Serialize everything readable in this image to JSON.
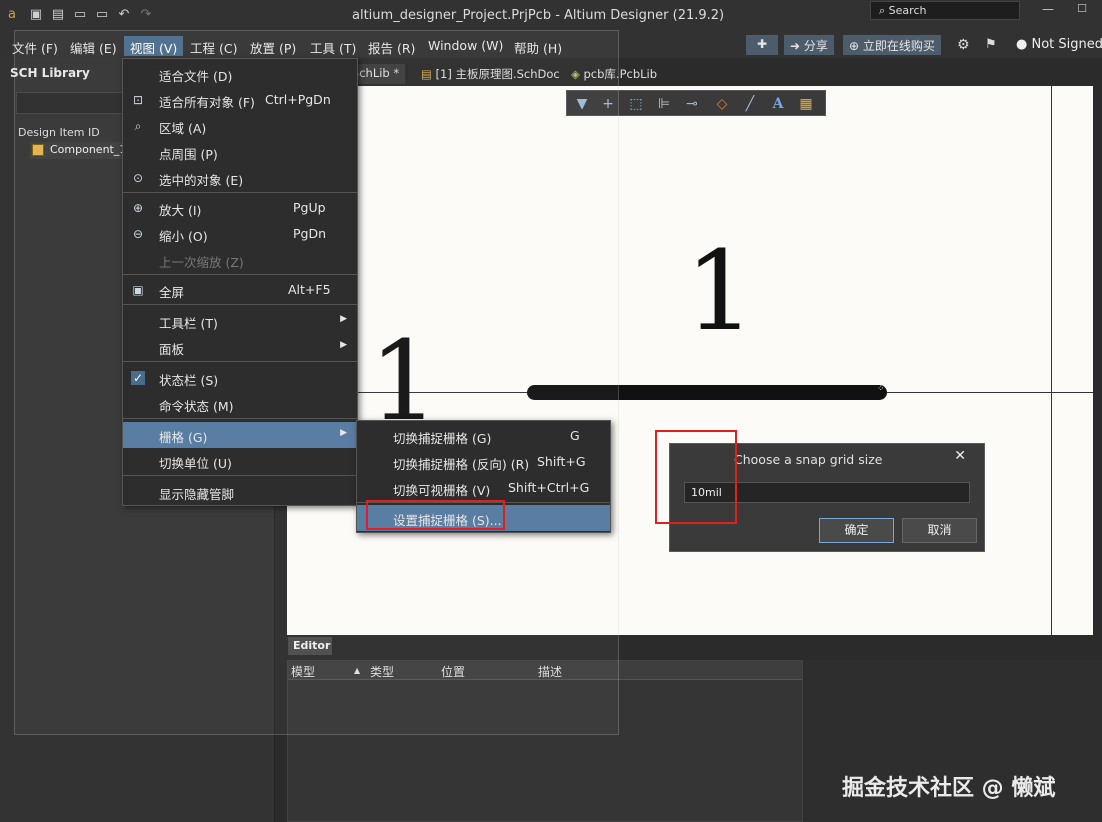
{
  "window": {
    "title": "altium_designer_Project.PrjPcb - Altium Designer (21.9.2)",
    "search_placeholder": "Search"
  },
  "menubar": [
    "文件 (F)",
    "编辑 (E)",
    "视图 (V)",
    "工程 (C)",
    "放置 (P)",
    "工具 (T)",
    "报告 (R)",
    "Window (W)",
    "帮助 (H)"
  ],
  "right_toolbar": {
    "share": "分享",
    "buy": "立即在线购买",
    "user": "Not Signed"
  },
  "left_panel": {
    "title": "SCH Library",
    "column": "Design Item ID",
    "item": "Component_1"
  },
  "tabs": [
    "E.SchLib *",
    "[1] 主板原理图.SchDoc",
    "pcb库.PcbLib"
  ],
  "canvas": {
    "label_top": "1",
    "label_left": "1"
  },
  "view_menu": {
    "items": [
      {
        "label": "适合文件 (D)",
        "shortcut": "",
        "icon": ""
      },
      {
        "label": "适合所有对象 (F)",
        "shortcut": "Ctrl+PgDn",
        "icon": "fit-all-icon"
      },
      {
        "label": "区域 (A)",
        "shortcut": "",
        "icon": "area-zoom-icon"
      },
      {
        "label": "点周围 (P)",
        "shortcut": "",
        "icon": ""
      },
      {
        "label": "选中的对象 (E)",
        "shortcut": "",
        "icon": "selected-zoom-icon"
      },
      {
        "label": "放大 (I)",
        "shortcut": "PgUp",
        "icon": "zoom-in-icon"
      },
      {
        "label": "缩小 (O)",
        "shortcut": "PgDn",
        "icon": "zoom-out-icon"
      },
      {
        "label": "上一次缩放 (Z)",
        "shortcut": "",
        "icon": ""
      },
      {
        "label": "全屏",
        "shortcut": "Alt+F5",
        "icon": "fullscreen-icon"
      },
      {
        "label": "工具栏 (T)",
        "shortcut": "",
        "icon": ""
      },
      {
        "label": "面板",
        "shortcut": "",
        "icon": ""
      },
      {
        "label": "状态栏 (S)",
        "shortcut": "",
        "icon": "check-icon"
      },
      {
        "label": "命令状态 (M)",
        "shortcut": "",
        "icon": ""
      },
      {
        "label": "栅格 (G)",
        "shortcut": "",
        "icon": ""
      },
      {
        "label": "切换单位 (U)",
        "shortcut": "",
        "icon": ""
      },
      {
        "label": "显示隐藏管脚",
        "shortcut": "",
        "icon": ""
      }
    ]
  },
  "grid_submenu": {
    "items": [
      {
        "label": "切换捕捉栅格 (G)",
        "shortcut": "G"
      },
      {
        "label": "切换捕捉栅格 (反向) (R)",
        "shortcut": "Shift+G"
      },
      {
        "label": "切换可视栅格 (V)",
        "shortcut": "Shift+Ctrl+G"
      },
      {
        "label": "设置捕捉栅格 (S)...",
        "shortcut": ""
      }
    ]
  },
  "dialog": {
    "title": "Choose a snap grid size",
    "value": "10mil",
    "ok": "确定",
    "cancel": "取消"
  },
  "editor": {
    "tab": "Editor",
    "columns": [
      "模型",
      "类型",
      "位置",
      "描述"
    ]
  },
  "watermark": "掘金技术社区 @ 懒斌",
  "colors": {
    "menu_highlight": "#5a7ea3",
    "red_annotation": "#e02020",
    "canvas_bg": "#fdfbf7"
  }
}
